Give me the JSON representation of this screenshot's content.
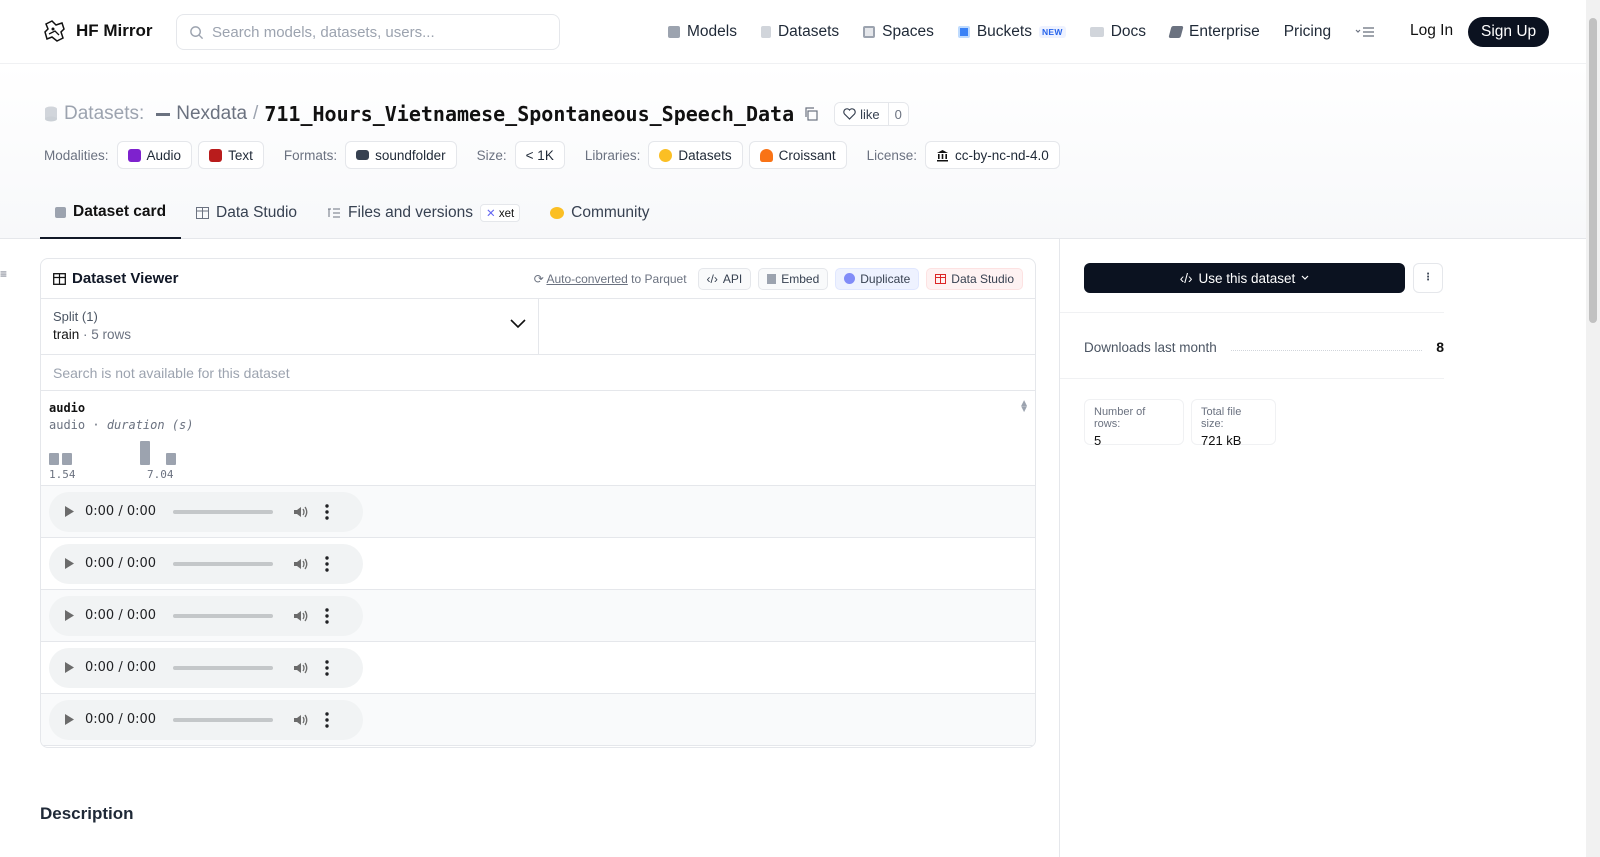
{
  "nav": {
    "brand": "HF Mirror",
    "search_placeholder": "Search models, datasets, users...",
    "links": [
      {
        "label": "Models",
        "icon": "cube-icon"
      },
      {
        "label": "Datasets",
        "icon": "database-icon"
      },
      {
        "label": "Spaces",
        "icon": "grid-icon"
      },
      {
        "label": "Buckets",
        "icon": "bucket-icon",
        "badge": "NEW"
      },
      {
        "label": "Docs",
        "icon": "book-icon"
      },
      {
        "label": "Enterprise",
        "icon": "enterprise-icon"
      },
      {
        "label": "Pricing"
      }
    ],
    "login": "Log In",
    "signup": "Sign Up"
  },
  "header": {
    "section": "Datasets:",
    "org": "Nexdata",
    "separator": "/",
    "repo": "711_Hours_Vietnamese_Spontaneous_Speech_Data",
    "like_label": "like",
    "like_count": "0",
    "meta": {
      "modalities_label": "Modalities:",
      "modalities": [
        "Audio",
        "Text"
      ],
      "formats_label": "Formats:",
      "format": "soundfolder",
      "size_label": "Size:",
      "size": "< 1K",
      "libraries_label": "Libraries:",
      "libraries": [
        "Datasets",
        "Croissant"
      ],
      "license_label": "License:",
      "license": "cc-by-nc-nd-4.0"
    },
    "tabs": [
      {
        "label": "Dataset card",
        "active": true
      },
      {
        "label": "Data Studio"
      },
      {
        "label": "Files and versions",
        "badge": "xet"
      },
      {
        "label": "Community"
      }
    ]
  },
  "viewer": {
    "title": "Dataset Viewer",
    "auto_converted_link": "Auto-converted",
    "auto_converted_suffix": "to Parquet",
    "buttons": {
      "api": "API",
      "embed": "Embed",
      "duplicate": "Duplicate",
      "studio": "Data Studio"
    },
    "split_label": "Split (1)",
    "split_value": "train",
    "split_rows": "5 rows",
    "search_unavailable": "Search is not available for this dataset",
    "column": {
      "name": "audio",
      "type": "audio",
      "stat": "duration (s)",
      "min": "1.54",
      "max": "7.04",
      "histogram": [
        1,
        1,
        0,
        0,
        0,
        0,
        0,
        2,
        0,
        1
      ]
    },
    "rows": [
      {
        "time": "0:00 / 0:00"
      },
      {
        "time": "0:00 / 0:00"
      },
      {
        "time": "0:00 / 0:00"
      },
      {
        "time": "0:00 / 0:00"
      },
      {
        "time": "0:00 / 0:00"
      }
    ]
  },
  "description_heading": "Description",
  "sidebar_right": {
    "use_button": "Use this dataset",
    "downloads_label": "Downloads last month",
    "downloads_value": "8",
    "rows_label": "Number of rows:",
    "rows_value": "5",
    "size_label": "Total file size:",
    "size_value": "721 kB"
  },
  "colors": {
    "dark": "#0b1220",
    "audio_tag": "#7e22ce",
    "text_tag": "#b91c1c",
    "xet_accent": "#6366f1"
  }
}
